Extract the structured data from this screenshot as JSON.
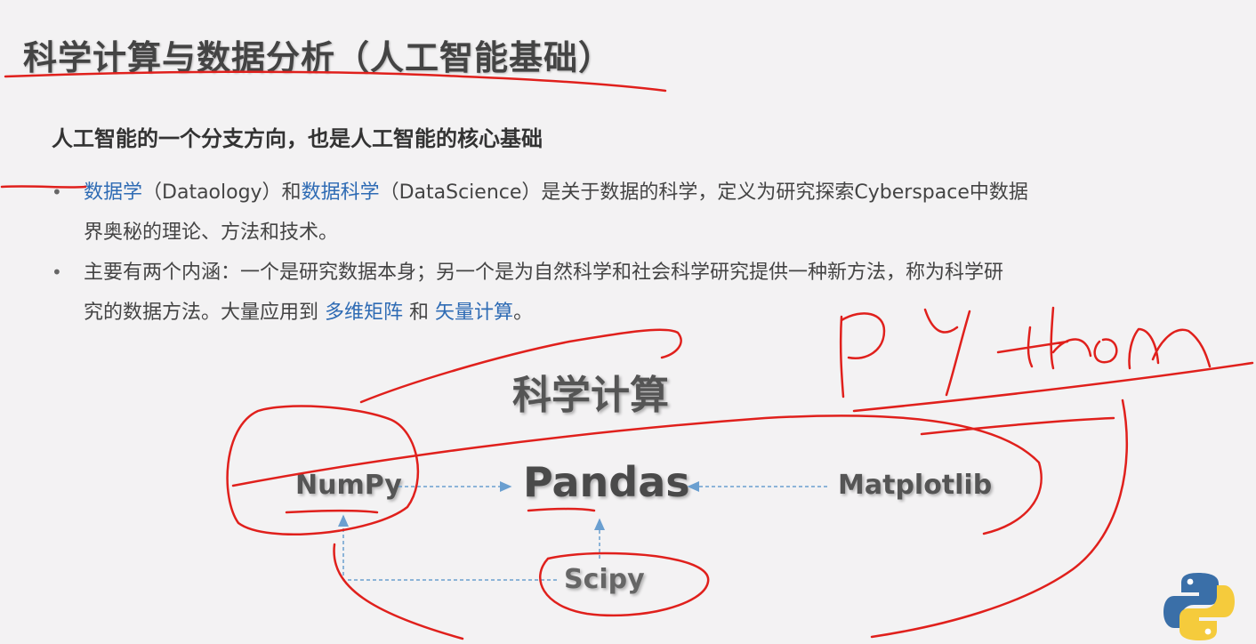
{
  "slide": {
    "title": "科学计算与数据分析（人工智能基础）",
    "subtitle": "人工智能的一个分支方向，也是人工智能的核心基础",
    "bullets": [
      {
        "line1_a": "数据学",
        "line1_b": "（Dataology）和",
        "line1_c": "数据科学",
        "line1_d": "（DataScience）是关于数据的科学，定义为研究探索Cyberspace中数据",
        "line2": "界奥秘的理论、方法和技术。"
      },
      {
        "line1": "主要有两个内涵：一个是研究数据本身；另一个是为自然科学和社会科学研究提供一种新方法，称为科学研",
        "line2_a": "究的数据方法。大量应用到",
        "line2_b": "多维矩阵",
        "line2_c": "和",
        "line2_d": "矢量计算",
        "line2_e": "。"
      }
    ],
    "bullet_symbol": "•"
  },
  "diagram": {
    "title": "科学计算",
    "nodes": {
      "numpy": "NumPy",
      "pandas": "Pandas",
      "matplotlib": "Matplotlib",
      "scipy": "Scipy"
    }
  },
  "colors": {
    "background": "#f3f2f3",
    "highlight": "#2e6bb4",
    "annotation": "#e0201c",
    "arrow": "#6a9fd0"
  },
  "icons": {
    "logo": "python-logo-icon"
  }
}
